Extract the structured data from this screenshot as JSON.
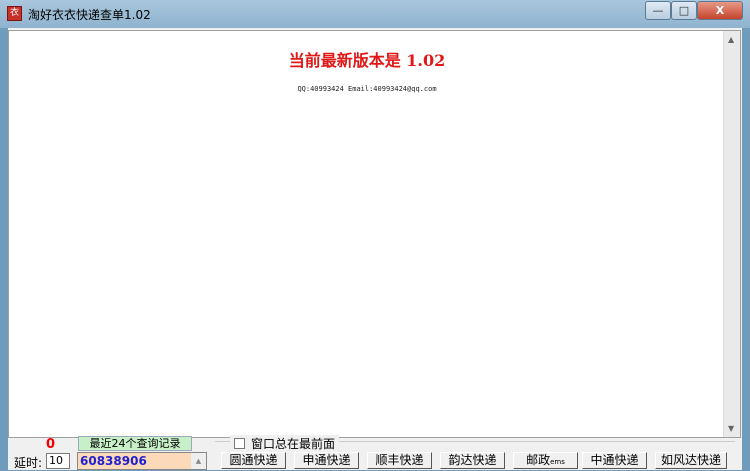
{
  "window": {
    "title": "淘好衣衣快递查单1.02",
    "icon_text": "衣",
    "minimize": "—",
    "maximize": "□",
    "close": "X"
  },
  "content": {
    "headline": "当前最新版本是 1.02",
    "contact": "QQ:40993424 Email:40993424@qq.com"
  },
  "bottom": {
    "counter": "0",
    "delay_label": "延时:",
    "delay_value": "10",
    "history_header": "最近24个查询记录",
    "history_value": "60838906",
    "always_on_top_label": "窗口总在最前面",
    "always_on_top_checked": false
  },
  "buttons": [
    {
      "label": "圆通快递"
    },
    {
      "label": "申通快递"
    },
    {
      "label": "顺丰快递"
    },
    {
      "label": "韵达快递"
    },
    {
      "label": "邮政",
      "suffix": "ems"
    },
    {
      "label": "中通快递"
    },
    {
      "label": "如风达快递"
    }
  ]
}
